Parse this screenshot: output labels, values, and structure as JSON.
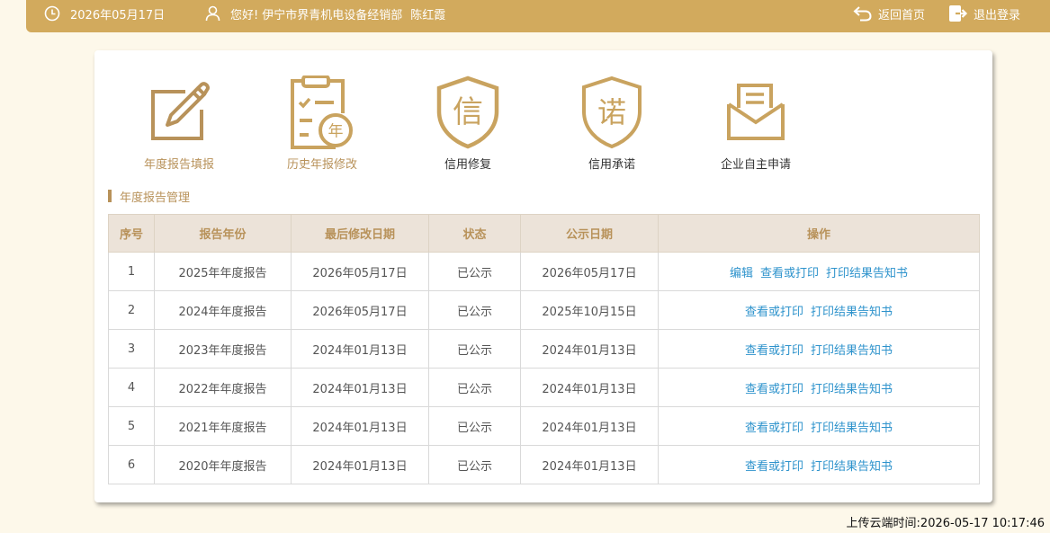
{
  "header": {
    "date": "2026年05月17日",
    "greeting": "您好!",
    "company": "伊宁市界青机电设备经销部",
    "user": "陈红霞",
    "home_label": "返回首页",
    "logout_label": "退出登录"
  },
  "functions": [
    {
      "label": "年度报告填报",
      "icon": "edit-icon"
    },
    {
      "label": "历史年报修改",
      "icon": "history-report-icon"
    },
    {
      "label": "信用修复",
      "icon": "credit-shield-icon"
    },
    {
      "label": "信用承诺",
      "icon": "promise-shield-icon"
    },
    {
      "label": "企业自主申请",
      "icon": "envelope-icon"
    }
  ],
  "icon_glyphs": {
    "year": "年",
    "credit": "信",
    "promise": "诺"
  },
  "colors": {
    "brand": "#d2aa5d",
    "icon_gold": "#c9a35f",
    "link": "#2e93cc",
    "active_label": "#b8925a"
  },
  "section": {
    "title": "年度报告管理"
  },
  "table": {
    "headers": [
      "序号",
      "报告年份",
      "最后修改日期",
      "状态",
      "公示日期",
      "操作"
    ],
    "rows": [
      {
        "no": "1",
        "year": "2025年年度报告",
        "modified": "2026年05月17日",
        "status": "已公示",
        "public": "2026年05月17日",
        "actions": [
          "编辑",
          "查看或打印",
          "打印结果告知书"
        ]
      },
      {
        "no": "2",
        "year": "2024年年度报告",
        "modified": "2026年05月17日",
        "status": "已公示",
        "public": "2025年10月15日",
        "actions": [
          "查看或打印",
          "打印结果告知书"
        ]
      },
      {
        "no": "3",
        "year": "2023年年度报告",
        "modified": "2024年01月13日",
        "status": "已公示",
        "public": "2024年01月13日",
        "actions": [
          "查看或打印",
          "打印结果告知书"
        ]
      },
      {
        "no": "4",
        "year": "2022年年度报告",
        "modified": "2024年01月13日",
        "status": "已公示",
        "public": "2024年01月13日",
        "actions": [
          "查看或打印",
          "打印结果告知书"
        ]
      },
      {
        "no": "5",
        "year": "2021年年度报告",
        "modified": "2024年01月13日",
        "status": "已公示",
        "public": "2024年01月13日",
        "actions": [
          "查看或打印",
          "打印结果告知书"
        ]
      },
      {
        "no": "6",
        "year": "2020年年度报告",
        "modified": "2024年01月13日",
        "status": "已公示",
        "public": "2024年01月13日",
        "actions": [
          "查看或打印",
          "打印结果告知书"
        ]
      }
    ]
  },
  "footer": {
    "upload_time": "上传云端时间:2026-05-17 10:17:46"
  }
}
